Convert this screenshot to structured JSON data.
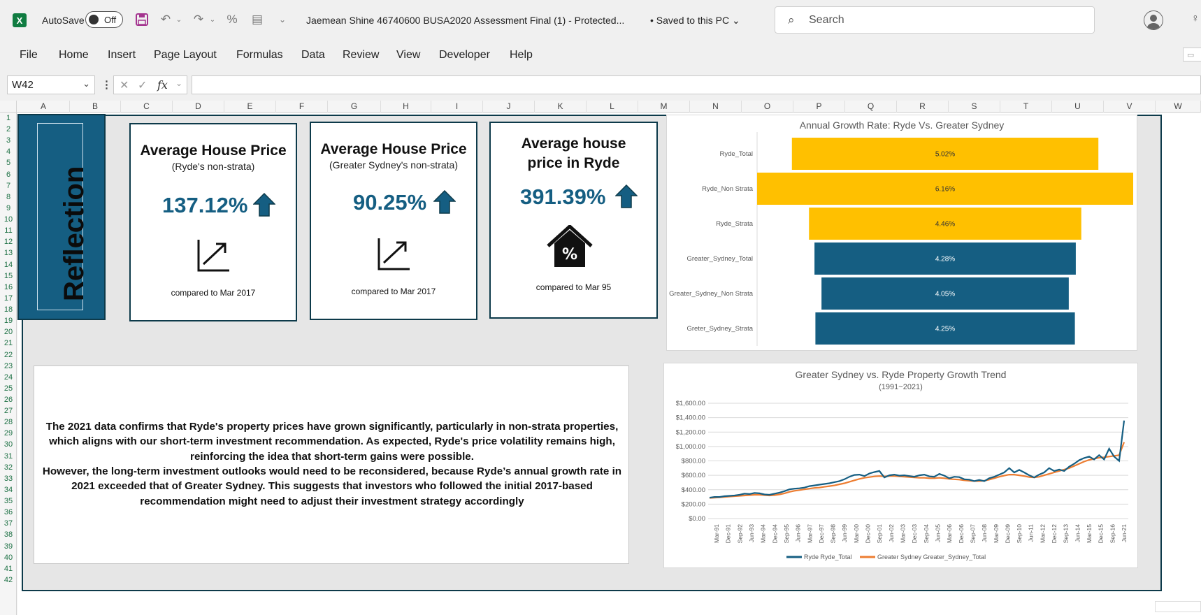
{
  "titlebar": {
    "autosave_label": "AutoSave",
    "autosave_state": "Off",
    "doc_title": "Jaemean Shine 46740600 BUSA2020 Assessment Final (1)  -  Protected...",
    "saved_status": "• Saved to this PC",
    "search_placeholder": "Search"
  },
  "ribbon": {
    "tabs": [
      "File",
      "Home",
      "Insert",
      "Page Layout",
      "Formulas",
      "Data",
      "Review",
      "View",
      "Developer",
      "Help"
    ]
  },
  "formula_bar": {
    "name_box": "W42",
    "fx": "fx",
    "value": ""
  },
  "grid": {
    "columns": [
      "A",
      "B",
      "C",
      "D",
      "E",
      "F",
      "G",
      "H",
      "I",
      "J",
      "K",
      "L",
      "M",
      "N",
      "O",
      "P",
      "Q",
      "R",
      "S",
      "T",
      "U",
      "V",
      "W"
    ],
    "rows": [
      "1",
      "2",
      "3",
      "4",
      "5",
      "6",
      "7",
      "8",
      "9",
      "10",
      "11",
      "12",
      "13",
      "14",
      "15",
      "16",
      "17",
      "18",
      "19",
      "20",
      "21",
      "22",
      "23",
      "24",
      "25",
      "26",
      "27",
      "28",
      "29",
      "30",
      "31",
      "32",
      "33",
      "34",
      "35",
      "36",
      "37",
      "38",
      "39",
      "40",
      "41",
      "42"
    ]
  },
  "dashboard": {
    "banner": "Reflection",
    "kpis": [
      {
        "title": "Average House Price",
        "subtitle": "(Ryde's non-strata)",
        "value": "137.12%",
        "compare": "compared to Mar 2017",
        "icon": "trend-up-icon"
      },
      {
        "title": "Average House Price",
        "subtitle": "(Greater Sydney's non-strata)",
        "value": "90.25%",
        "compare": "compared to Mar 2017",
        "icon": "trend-up-icon"
      },
      {
        "title": "Average house price in Ryde",
        "subtitle": "",
        "value": "391.39%",
        "compare": "compared to Mar 95",
        "icon": "house-percent-icon"
      }
    ],
    "reflection_text": [
      "The 2021 data confirms that Ryde's property prices have grown significantly, particularly in non-strata properties, which aligns with our short-term investment recommendation. As expected, Ryde's price volatility remains high, reinforcing the idea that short-term gains were possible.",
      "However, the long-term investment outlooks would need to be reconsidered, because Ryde’s annual growth rate in 2021 exceeded that of Greater Sydney. This suggests that investors who followed the initial 2017-based recommendation might need to adjust their investment strategy accordingly"
    ],
    "colors": {
      "navy": "#155e82",
      "gold": "#ffc000",
      "orange": "#ed7d31",
      "frame": "#0d3a4a"
    }
  },
  "chart_data": [
    {
      "type": "bar",
      "orientation": "horizontal",
      "title": "Annual Growth Rate: Ryde Vs. Greater Sydney",
      "categories": [
        "Ryde_Total",
        "Ryde_Non Strata",
        "Ryde_Strata",
        "Greater_Sydney_Total",
        "Greater_Sydney_Non Strata",
        "Greter_Sydney_Strata"
      ],
      "values": [
        5.02,
        6.16,
        4.46,
        4.28,
        4.05,
        4.25
      ],
      "labels": [
        "5.02%",
        "6.16%",
        "4.46%",
        "4.28%",
        "4.05%",
        "4.25%"
      ],
      "bar_colors": [
        "#ffc000",
        "#ffc000",
        "#ffc000",
        "#155e82",
        "#155e82",
        "#155e82"
      ],
      "centered": true
    },
    {
      "type": "line",
      "title": "Greater Sydney vs. Ryde Property Growth Trend",
      "subtitle": "(1991~2021)",
      "ylim": [
        0,
        1600
      ],
      "y_ticks": [
        "$0.00",
        "$200.00",
        "$400.00",
        "$600.00",
        "$800.00",
        "$1,000.00",
        "$1,200.00",
        "$1,400.00",
        "$1,600.00"
      ],
      "x_ticks": [
        "Mar-91",
        "Dec-91",
        "Sep-92",
        "Jun-93",
        "Mar-94",
        "Dec-94",
        "Sep-95",
        "Jun-96",
        "Mar-97",
        "Dec-97",
        "Sep-98",
        "Jun-99",
        "Mar-00",
        "Dec-00",
        "Sep-01",
        "Jun-02",
        "Mar-03",
        "Dec-03",
        "Sep-04",
        "Jun-05",
        "Mar-06",
        "Dec-06",
        "Sep-07",
        "Jun-08",
        "Mar-09",
        "Dec-09",
        "Sep-10",
        "Jun-11",
        "Mar-12",
        "Dec-12",
        "Sep-13",
        "Jun-14",
        "Mar-15",
        "Dec-15",
        "Sep-16",
        "Jun-21"
      ],
      "legend": "bottom",
      "series": [
        {
          "name": "Ryde Ryde_Total",
          "color": "#155e82",
          "values": [
            290,
            300,
            300,
            310,
            315,
            320,
            330,
            345,
            340,
            355,
            350,
            335,
            330,
            345,
            360,
            380,
            405,
            415,
            420,
            430,
            450,
            460,
            470,
            480,
            490,
            505,
            520,
            545,
            580,
            605,
            610,
            590,
            625,
            645,
            660,
            570,
            600,
            610,
            595,
            600,
            590,
            580,
            600,
            610,
            585,
            580,
            620,
            595,
            560,
            580,
            575,
            545,
            540,
            520,
            535,
            520,
            560,
            580,
            610,
            640,
            700,
            640,
            675,
            640,
            600,
            570,
            610,
            640,
            700,
            660,
            680,
            660,
            720,
            760,
            810,
            840,
            860,
            820,
            880,
            820,
            970,
            860,
            800,
            1360
          ]
        },
        {
          "name": "Greater Sydney Greater_Sydney_Total",
          "color": "#ed7d31",
          "values": [
            285,
            290,
            295,
            300,
            305,
            310,
            315,
            320,
            325,
            330,
            330,
            325,
            320,
            325,
            335,
            350,
            370,
            385,
            395,
            405,
            415,
            425,
            430,
            440,
            450,
            460,
            475,
            490,
            510,
            530,
            550,
            565,
            575,
            585,
            590,
            585,
            590,
            590,
            585,
            580,
            575,
            570,
            565,
            565,
            560,
            560,
            565,
            560,
            550,
            545,
            540,
            530,
            525,
            520,
            520,
            525,
            540,
            560,
            580,
            595,
            610,
            610,
            600,
            590,
            575,
            570,
            580,
            600,
            620,
            640,
            660,
            680,
            700,
            730,
            760,
            790,
            815,
            830,
            845,
            850,
            860,
            870,
            880,
            1060
          ]
        }
      ]
    }
  ]
}
